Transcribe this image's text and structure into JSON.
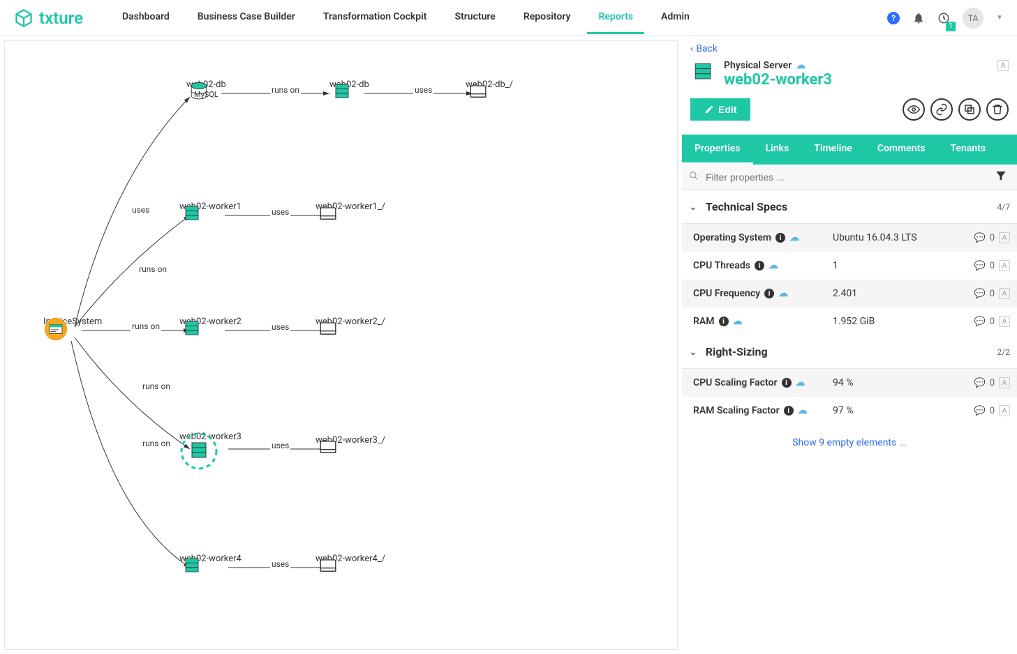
{
  "logo": "txture",
  "nav": {
    "items": [
      "Dashboard",
      "Business Case Builder",
      "Transformation Cockpit",
      "Structure",
      "Repository",
      "Reports",
      "Admin"
    ],
    "active": "Reports",
    "badge": "1",
    "avatar": "TA"
  },
  "graph": {
    "root": {
      "label": "InvoiceSystem"
    },
    "nodes": {
      "db": {
        "label": "web02-db",
        "sub": "MySQL"
      },
      "dbsrv": {
        "label": "web02-db"
      },
      "dbstore": {
        "label": "web02-db_/"
      },
      "w1": {
        "label": "web02-worker1"
      },
      "w1s": {
        "label": "web02-worker1_/"
      },
      "w2": {
        "label": "web02-worker2"
      },
      "w2s": {
        "label": "web02-worker2_/"
      },
      "w3": {
        "label": "web02-worker3"
      },
      "w3s": {
        "label": "web02-worker3_/"
      },
      "w4": {
        "label": "web02-worker4"
      },
      "w4s": {
        "label": "web02-worker4_/"
      }
    },
    "edges": {
      "uses": "uses",
      "runs_on": "runs on"
    }
  },
  "side": {
    "back": "Back",
    "type": "Physical Server",
    "title": "web02-worker3",
    "edit": "Edit",
    "tabs": [
      "Properties",
      "Links",
      "Timeline",
      "Comments",
      "Tenants"
    ],
    "active_tab": "Properties",
    "filter_placeholder": "Filter properties ...",
    "sections": [
      {
        "title": "Technical Specs",
        "count": "4/7",
        "rows": [
          {
            "label": "Operating System",
            "value": "Ubuntu 16.04.3 LTS",
            "comments": "0"
          },
          {
            "label": "CPU Threads",
            "value": "1",
            "comments": "0"
          },
          {
            "label": "CPU Frequency",
            "value": "2.401",
            "comments": "0"
          },
          {
            "label": "RAM",
            "value": "1.952 GiB",
            "comments": "0"
          }
        ]
      },
      {
        "title": "Right-Sizing",
        "count": "2/2",
        "rows": [
          {
            "label": "CPU Scaling Factor",
            "value": "94 %",
            "comments": "0"
          },
          {
            "label": "RAM Scaling Factor",
            "value": "97 %",
            "comments": "0"
          }
        ]
      }
    ],
    "show_empty": "Show 9 empty elements ..."
  }
}
